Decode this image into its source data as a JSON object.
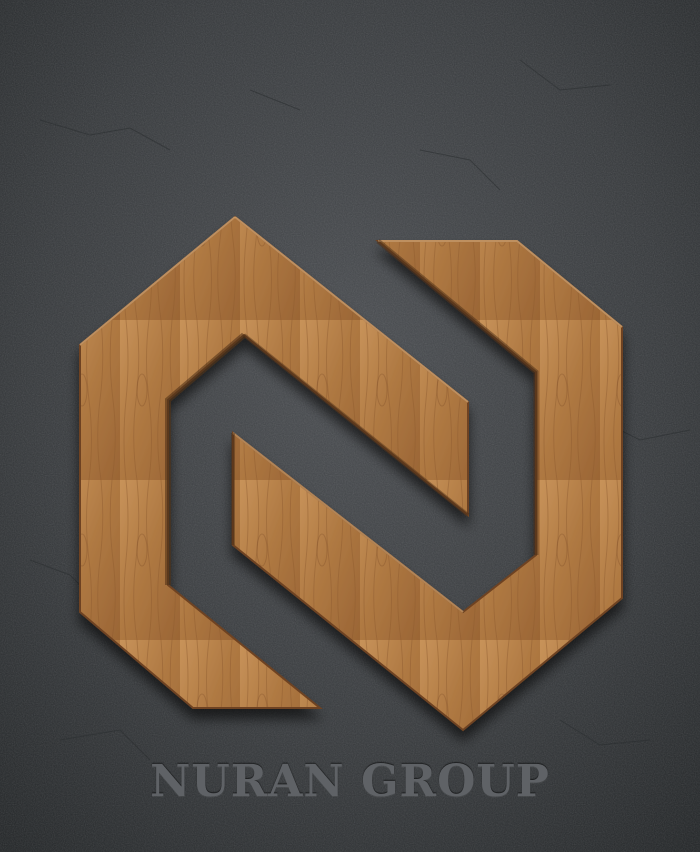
{
  "brand": {
    "name": "NURAN GROUP"
  },
  "logo": {
    "icon": "hexagon-n-monogram-icon",
    "material": "wood"
  },
  "colors": {
    "background": "#3a3d40",
    "background_dark": "#23262a",
    "wood_light": "#c08a52",
    "wood_mid": "#a9713e",
    "wood_dark": "#7c4f29",
    "brand_text": "#5f6266"
  }
}
